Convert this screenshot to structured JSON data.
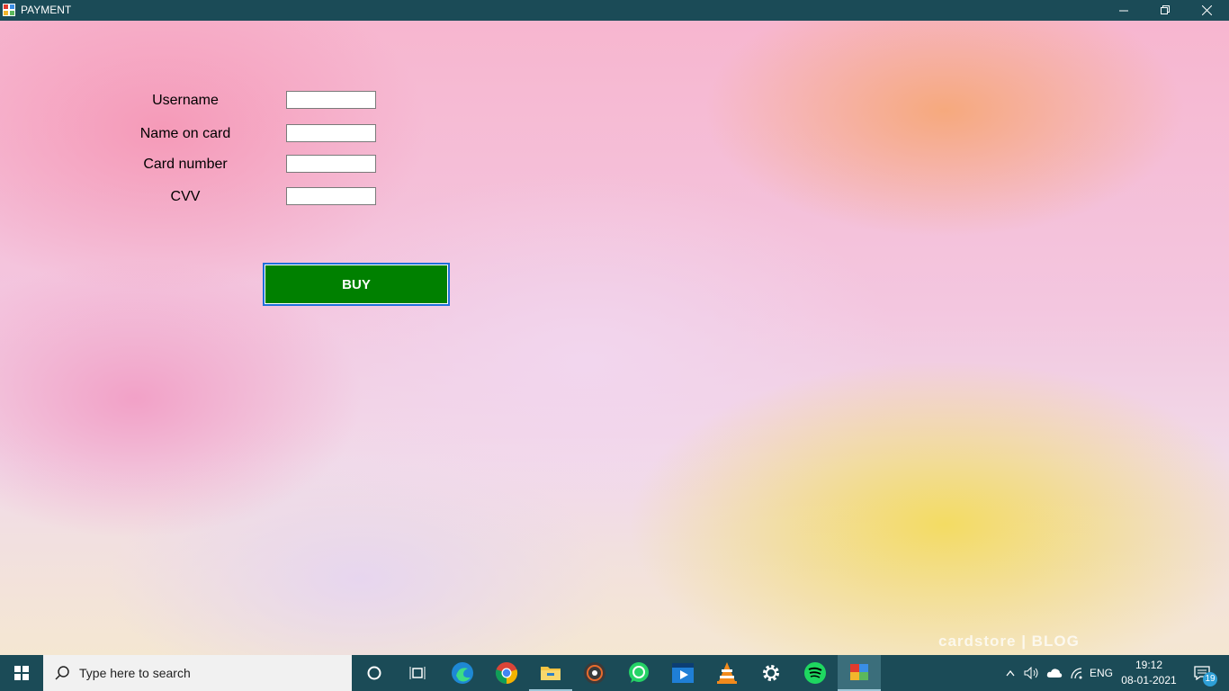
{
  "window": {
    "title": "PAYMENT"
  },
  "form": {
    "fields": [
      {
        "label": "Username",
        "value": ""
      },
      {
        "label": "Name on card",
        "value": ""
      },
      {
        "label": "Card number",
        "value": ""
      },
      {
        "label": "CVV",
        "value": ""
      }
    ],
    "buy_label": "BUY"
  },
  "background": {
    "watermark": "cardstore | BLOG"
  },
  "taskbar": {
    "search_placeholder": "Type here to search",
    "apps": [
      "cortana",
      "task-view",
      "edge",
      "chrome",
      "file-explorer",
      "music-player",
      "whatsapp",
      "video-editor",
      "vlc",
      "settings",
      "spotify",
      "payment-app"
    ],
    "language": "ENG",
    "time": "19:12",
    "date": "08-01-2021",
    "notification_count": "19"
  },
  "colors": {
    "titlebar": "#1b4b57",
    "buy_button": "#008000",
    "focus_border": "#1f6fd9"
  }
}
